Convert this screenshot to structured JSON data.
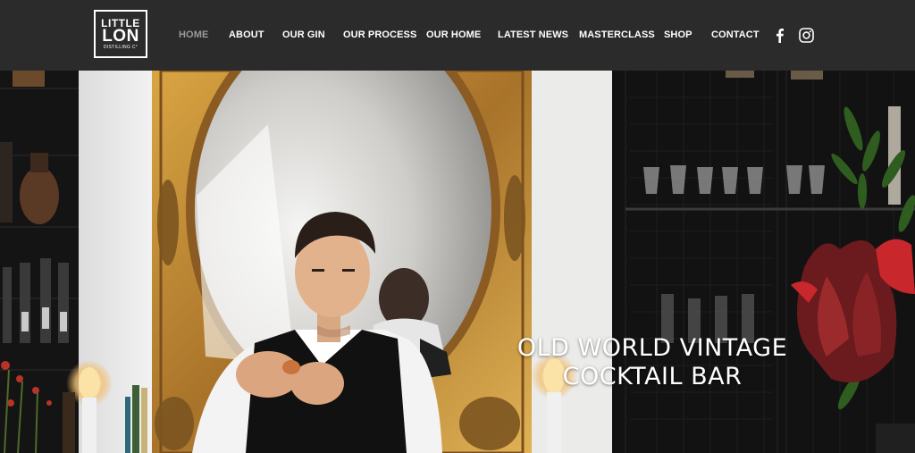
{
  "brand": {
    "line1": "LITTLE",
    "line2": "LON",
    "line3": "DISTILLING C°"
  },
  "nav": {
    "items": [
      {
        "label": "HOME",
        "active": true
      },
      {
        "label": "ABOUT",
        "active": false
      },
      {
        "label": "OUR GIN",
        "active": false
      },
      {
        "label": "OUR PROCESS",
        "active": false
      },
      {
        "label": "OUR HOME",
        "active": false
      },
      {
        "label": "LATEST NEWS",
        "active": false
      },
      {
        "label": "MASTERCLASS",
        "active": false
      },
      {
        "label": "SHOP",
        "active": false
      },
      {
        "label": "CONTACT",
        "active": false
      }
    ]
  },
  "social": [
    "facebook-icon",
    "instagram-icon"
  ],
  "hero": {
    "title_line1": "OLD WORLD VINTAGE",
    "title_line2": "COCKTAIL BAR"
  },
  "colors": {
    "header_bg": "#2b2b2b",
    "nav_text": "#ffffff",
    "nav_active": "#9a9a9a",
    "frame_gold": "#b9862e"
  }
}
